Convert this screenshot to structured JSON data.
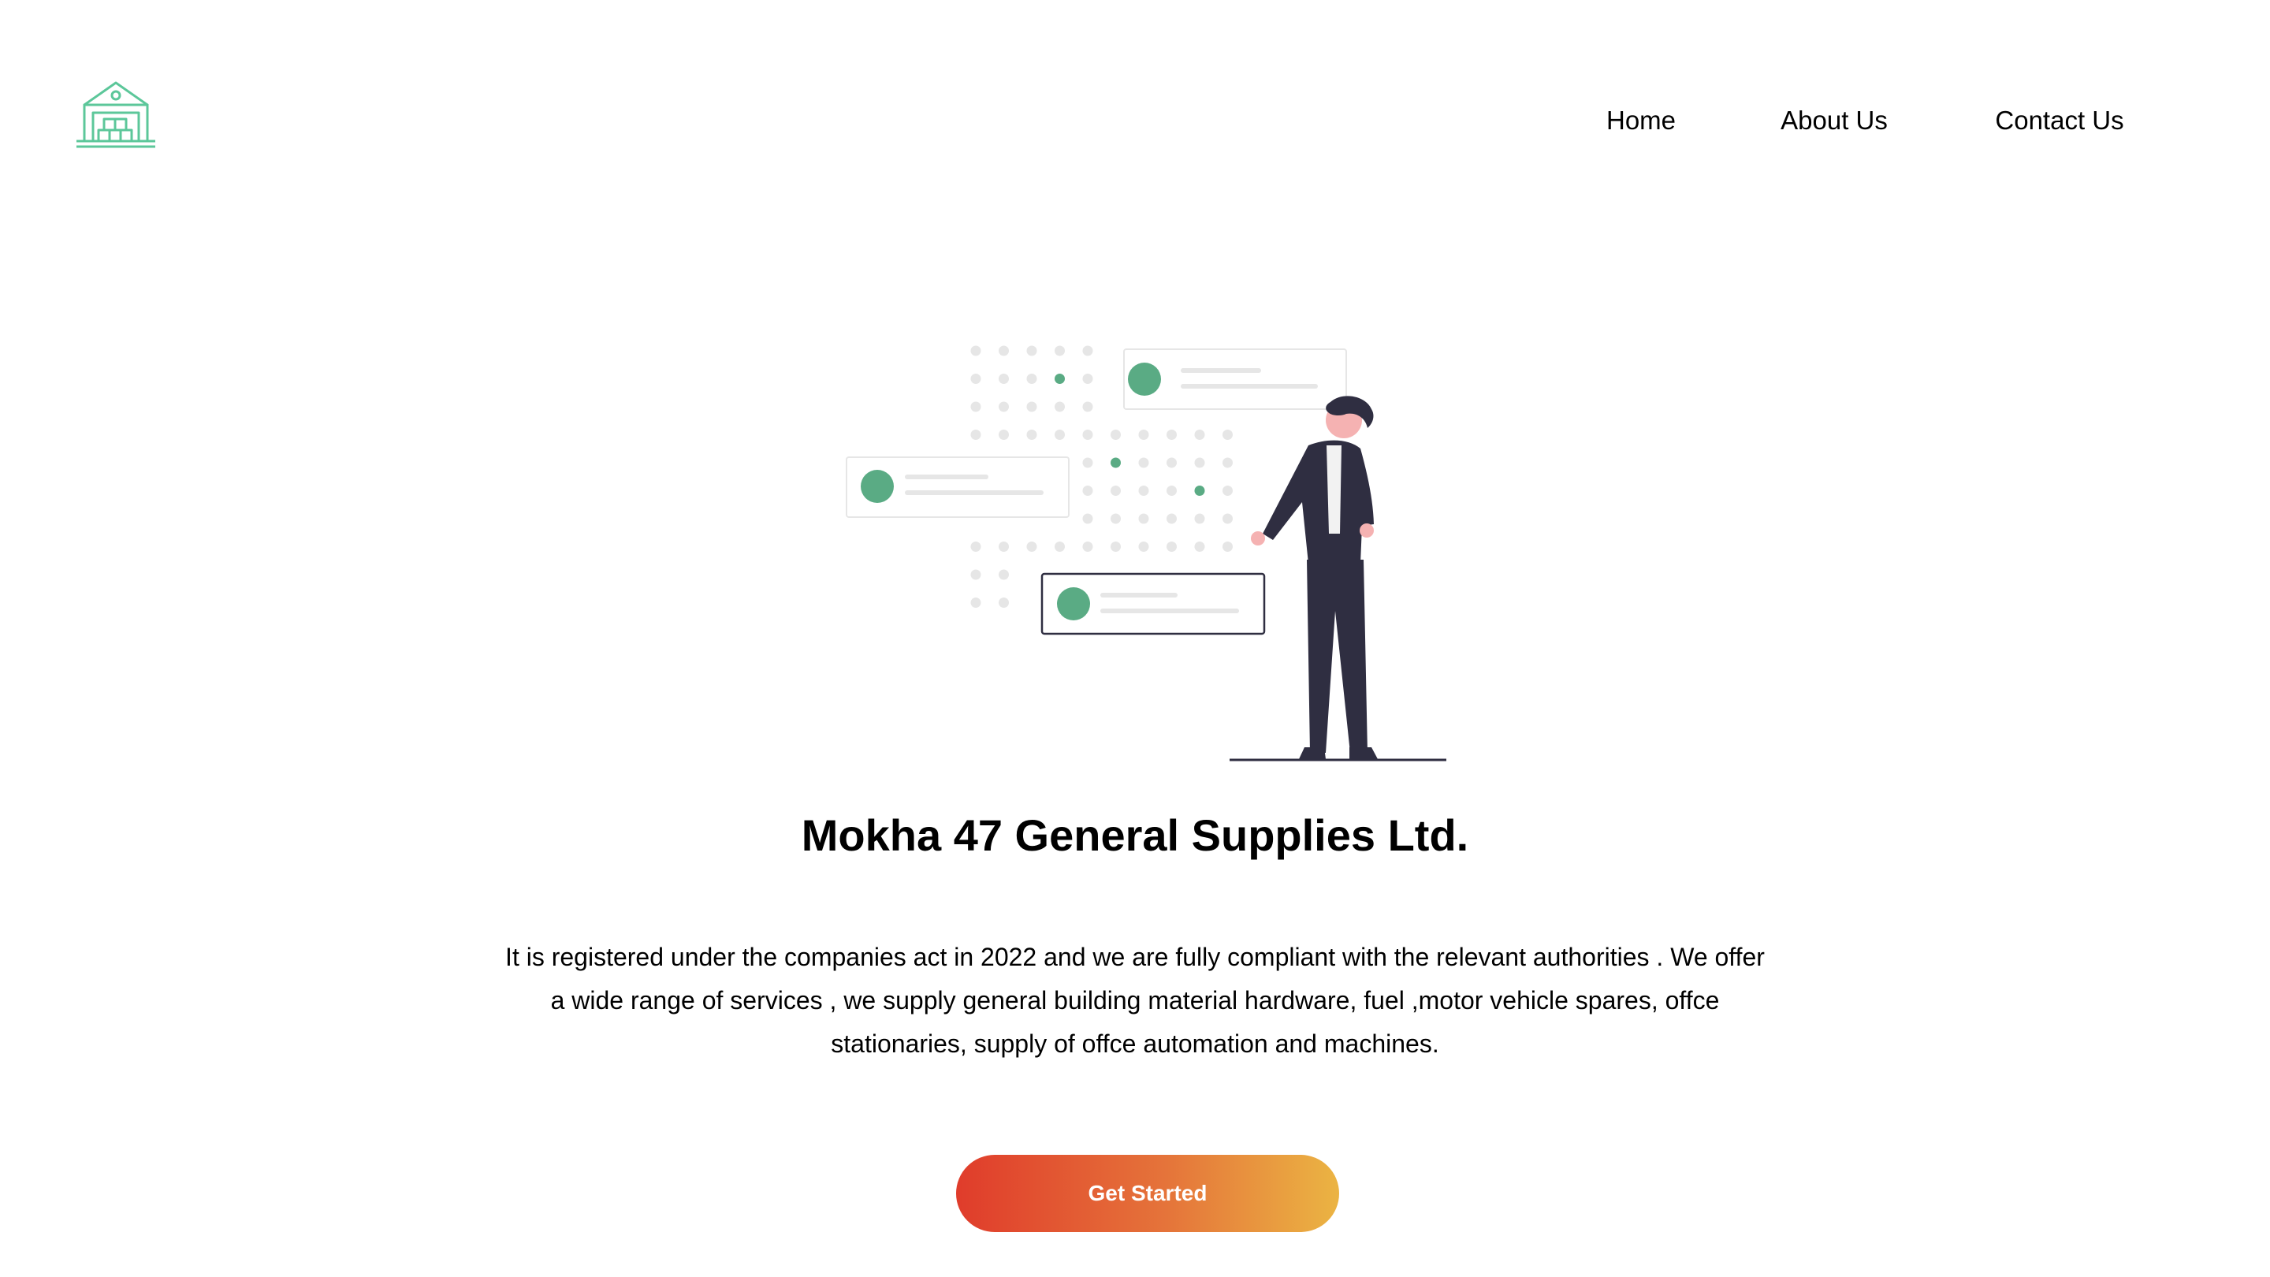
{
  "colors": {
    "accent_green": "#5aab84",
    "logo_green": "#5cc79a",
    "button_gradient_start": "#e03c2b",
    "button_gradient_end": "#ebb443",
    "figure_dark": "#2f2e41",
    "skin": "#f5b2b2"
  },
  "header": {
    "logo_icon": "warehouse-icon",
    "nav": {
      "home": "Home",
      "about": "About Us",
      "contact": "Contact Us"
    }
  },
  "hero": {
    "illustration_icon": "person-presenting-cards-illustration",
    "title": "Mokha 47 General Supplies Ltd.",
    "description": "It is registered under the companies act in 2022 and we are fully compliant with the relevant authorities . We offer a wide range of services , we supply general building material hardware, fuel ,motor vehicle spares, offce stationaries, supply of offce automation and machines.",
    "cta_label": "Get Started"
  }
}
